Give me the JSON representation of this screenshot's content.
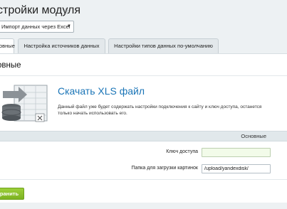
{
  "header": {
    "title": "стройки модуля",
    "star_icon": "star-icon"
  },
  "module_select": {
    "value": "Импорт данных через Excel"
  },
  "tabs": [
    {
      "label": "овные",
      "active": true
    },
    {
      "label": "Настройка источников данных",
      "active": false
    },
    {
      "label": "Настройки типов данных по-умолчанию",
      "active": false
    }
  ],
  "section": {
    "title": "овные"
  },
  "download": {
    "icon": "xls-file-database-icon",
    "title": "Скачать XLS файл",
    "description": "Данный файл уже будет содержать настройки подключения к сайту и ключ доступа, останется только начать использовать его."
  },
  "settings": {
    "heading": "Основные",
    "fields": [
      {
        "label": "Ключ доступа",
        "value": ""
      },
      {
        "label": "Папка для загрузки картинок",
        "value": "/upload/yandexdisk/"
      }
    ]
  },
  "footer": {
    "save_label": "ранить"
  },
  "colors": {
    "accent_link": "#1b75b7",
    "save_button": "#8cc12c",
    "page_bg": "#edf1f3"
  }
}
